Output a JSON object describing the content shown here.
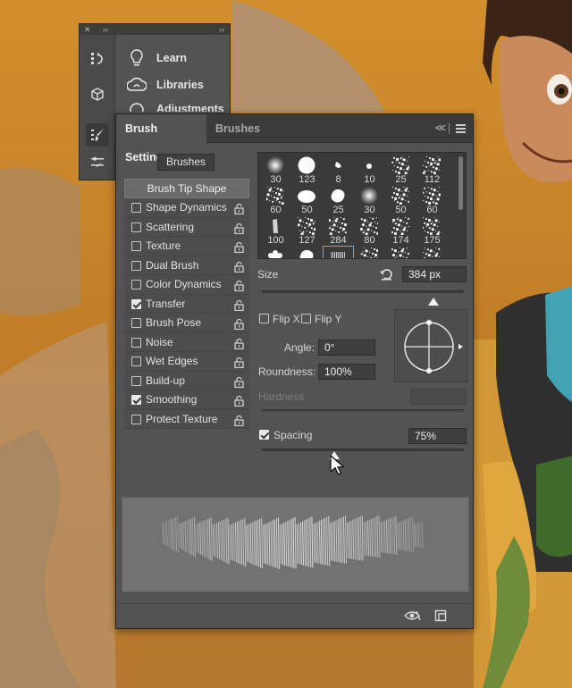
{
  "dock": {
    "items": [
      {
        "label": "Learn",
        "icon": "lightbulb-icon"
      },
      {
        "label": "Libraries",
        "icon": "libraries-icon"
      },
      {
        "label": "Adjustments",
        "icon": "adjustments-icon"
      }
    ]
  },
  "panel": {
    "tabs": [
      {
        "label": "Brush Settings",
        "active": true
      },
      {
        "label": "Brushes",
        "active": false
      }
    ],
    "collapse_glyph": "<<",
    "brushes_button": "Brushes",
    "tip_shape": "Brush Tip Shape",
    "options": [
      {
        "label": "Shape Dynamics",
        "checked": false
      },
      {
        "label": "Scattering",
        "checked": false
      },
      {
        "label": "Texture",
        "checked": false
      },
      {
        "label": "Dual Brush",
        "checked": false
      },
      {
        "label": "Color Dynamics",
        "checked": false
      },
      {
        "label": "Transfer",
        "checked": true
      },
      {
        "label": "Brush Pose",
        "checked": false
      },
      {
        "label": "Noise",
        "checked": false
      },
      {
        "label": "Wet Edges",
        "checked": false
      },
      {
        "label": "Build-up",
        "checked": false
      },
      {
        "label": "Smoothing",
        "checked": true
      },
      {
        "label": "Protect Texture",
        "checked": false
      }
    ],
    "brush_grid": [
      "30",
      "123",
      "8",
      "10",
      "25",
      "112",
      "60",
      "50",
      "25",
      "30",
      "50",
      "60",
      "100",
      "127",
      "284",
      "80",
      "174",
      "175",
      "",
      "",
      "",
      "",
      "",
      ""
    ],
    "selected_brush_index": 20,
    "size": {
      "label": "Size",
      "value": "384 px",
      "slider_fraction": 0.85
    },
    "flip_x": {
      "label": "Flip X",
      "checked": false
    },
    "flip_y": {
      "label": "Flip Y",
      "checked": false
    },
    "angle": {
      "label": "Angle:",
      "value": "0°"
    },
    "roundness": {
      "label": "Roundness:",
      "value": "100%"
    },
    "hardness": {
      "label": "Hardness",
      "value": ""
    },
    "spacing": {
      "label": "Spacing",
      "value": "75%",
      "checked": true,
      "slider_fraction": 0.36
    }
  },
  "colors": {
    "panel_bg": "#535353",
    "tab_bar": "#3b3b3b",
    "selection": "#6fa8dc",
    "background_orange": "#c98a2e"
  }
}
